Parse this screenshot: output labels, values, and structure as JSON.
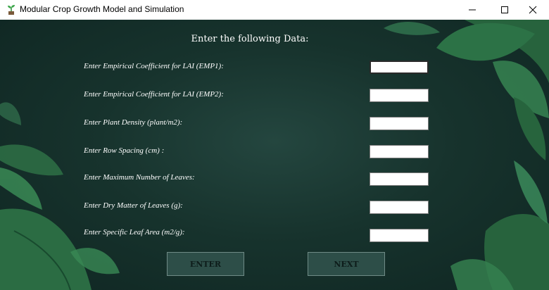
{
  "window": {
    "title": "Modular Crop Growth Model and Simulation",
    "app_icon": "seedling-icon",
    "controls": [
      "minimize-icon",
      "maximize-icon",
      "close-icon"
    ]
  },
  "form": {
    "heading": "Enter the following Data:",
    "fields": [
      {
        "label": "Enter Empirical Coefficient for LAI (EMP1):",
        "value": ""
      },
      {
        "label": "Enter Empirical Coefficient for LAI (EMP2):",
        "value": ""
      },
      {
        "label": "Enter Plant Density (plant/m2):",
        "value": ""
      },
      {
        "label": "Enter Row Spacing (cm) :",
        "value": ""
      },
      {
        "label": "Enter Maximum Number of Leaves:",
        "value": ""
      },
      {
        "label": "Enter Dry Matter of Leaves (g):",
        "value": ""
      },
      {
        "label": "Enter Specific Leaf Area (m2/g):",
        "value": ""
      }
    ]
  },
  "buttons": {
    "enter_label": "ENTER",
    "next_label": "NEXT"
  },
  "colors": {
    "background": "#17332d",
    "leaf": "#2f7a4a",
    "button": "#2d4e48"
  }
}
